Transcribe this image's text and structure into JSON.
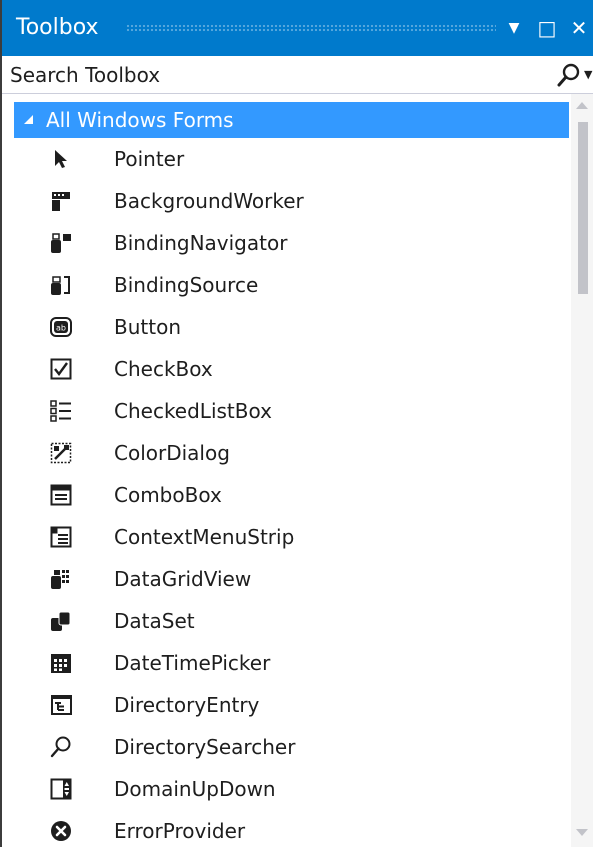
{
  "window": {
    "title": "Toolbox",
    "buttons": {
      "dropdown": "▼",
      "maximize": "□",
      "close": "✕"
    }
  },
  "search": {
    "placeholder": "Search Toolbox"
  },
  "category": {
    "label": "All Windows Forms",
    "expanded": true
  },
  "items": [
    {
      "label": "Pointer",
      "icon": "pointer-icon"
    },
    {
      "label": "BackgroundWorker",
      "icon": "background-worker-icon"
    },
    {
      "label": "BindingNavigator",
      "icon": "binding-navigator-icon"
    },
    {
      "label": "BindingSource",
      "icon": "binding-source-icon"
    },
    {
      "label": "Button",
      "icon": "button-control-icon"
    },
    {
      "label": "CheckBox",
      "icon": "checkbox-icon"
    },
    {
      "label": "CheckedListBox",
      "icon": "checked-list-box-icon"
    },
    {
      "label": "ColorDialog",
      "icon": "color-dialog-icon"
    },
    {
      "label": "ComboBox",
      "icon": "combo-box-icon"
    },
    {
      "label": "ContextMenuStrip",
      "icon": "context-menu-strip-icon"
    },
    {
      "label": "DataGridView",
      "icon": "data-grid-view-icon"
    },
    {
      "label": "DataSet",
      "icon": "data-set-icon"
    },
    {
      "label": "DateTimePicker",
      "icon": "date-time-picker-icon"
    },
    {
      "label": "DirectoryEntry",
      "icon": "directory-entry-icon"
    },
    {
      "label": "DirectorySearcher",
      "icon": "directory-searcher-icon"
    },
    {
      "label": "DomainUpDown",
      "icon": "domain-up-down-icon"
    },
    {
      "label": "ErrorProvider",
      "icon": "error-provider-icon"
    }
  ],
  "colors": {
    "title_bar": "#007acc",
    "selection": "#3399ff",
    "text": "#1e1e1e",
    "icon": "#1e1e1e"
  }
}
